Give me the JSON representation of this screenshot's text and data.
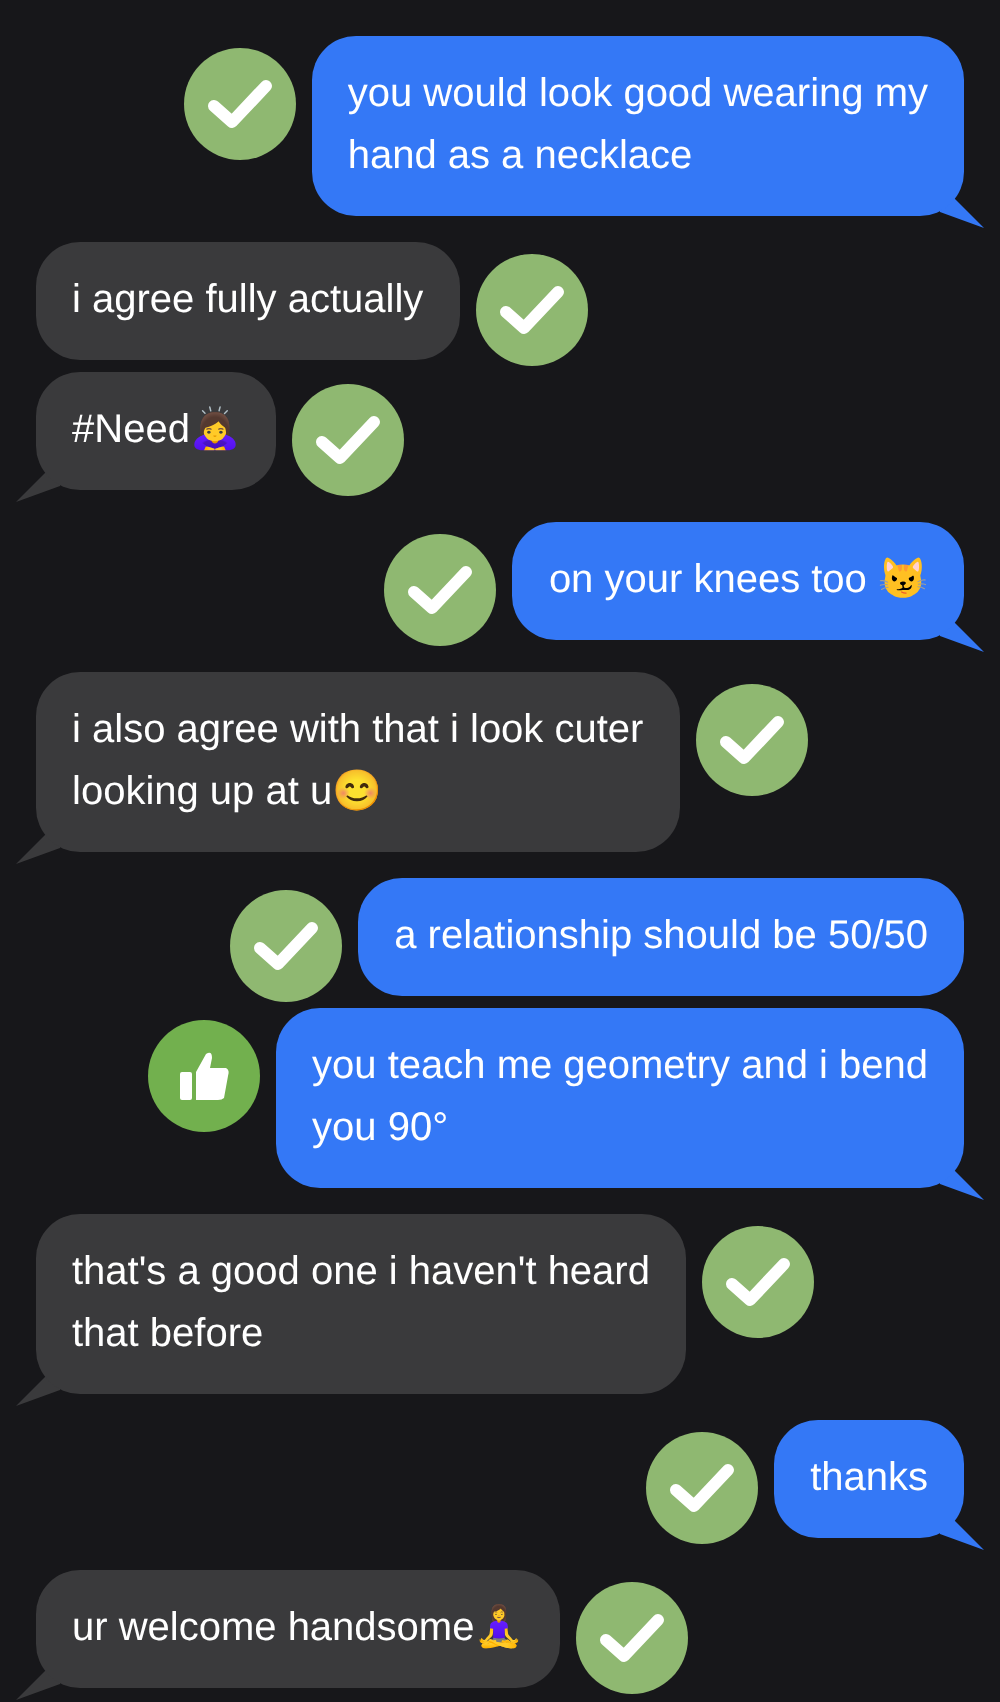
{
  "messages": [
    {
      "kind": "sent",
      "text": "you would look good wearing my\nhand as a necklace",
      "tail": true,
      "reaction": {
        "kind": "check"
      }
    },
    {
      "kind": "received",
      "text": "i agree fully actually",
      "tail": false,
      "reaction": {
        "kind": "check"
      }
    },
    {
      "kind": "received",
      "text": "#Need🙇‍♀️",
      "tail": true,
      "reaction": {
        "kind": "check"
      }
    },
    {
      "kind": "sent",
      "text": "on your knees too 😼",
      "tail": true,
      "reaction": {
        "kind": "check"
      }
    },
    {
      "kind": "received",
      "text": "i also agree with that i look cuter\nlooking up at u😊",
      "tail": true,
      "reaction": {
        "kind": "check"
      }
    },
    {
      "kind": "sent",
      "text": "a relationship should be 50/50",
      "tail": false,
      "reaction": {
        "kind": "check"
      }
    },
    {
      "kind": "sent",
      "text": "you teach me geometry and i bend\nyou 90°",
      "tail": true,
      "reaction": {
        "kind": "thumbs_up"
      }
    },
    {
      "kind": "received",
      "text": "that's a good one i haven't heard\nthat before",
      "tail": true,
      "reaction": {
        "kind": "check"
      }
    },
    {
      "kind": "sent",
      "text": "thanks",
      "tail": true,
      "reaction": {
        "kind": "check"
      }
    },
    {
      "kind": "received",
      "text": "ur welcome handsome🧘‍♀️",
      "tail": true,
      "reaction": {
        "kind": "check"
      }
    }
  ]
}
